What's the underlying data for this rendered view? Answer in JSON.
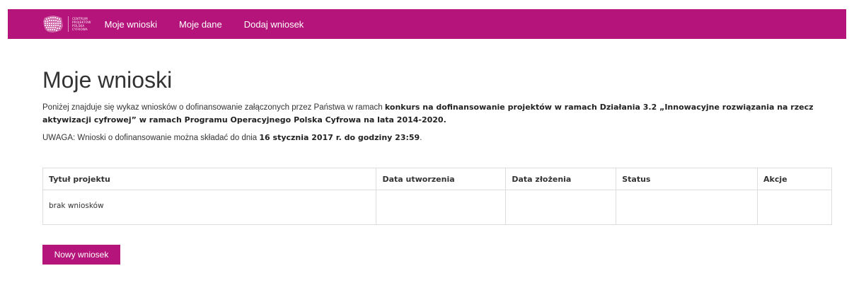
{
  "colors": {
    "brand": "#b5157a",
    "text": "#333333",
    "border": "#dddddd"
  },
  "navbar": {
    "logo": {
      "lines": [
        "CENTRUM",
        "PROJEKTÓW",
        "POLSKA",
        "CYFROWA"
      ],
      "icon": "poland-map-icon"
    },
    "links": [
      "Moje wnioski",
      "Moje dane",
      "Dodaj wniosek"
    ]
  },
  "page": {
    "title": "Moje wnioski",
    "intro_plain": "Poniżej znajduje się wykaz wniosków o dofinansowanie załączonych przez Państwa w ramach ",
    "intro_bold": "konkurs na dofinansowanie projektów w ramach Działania 3.2 „Innowacyjne rozwiązania na rzecz aktywizacji cyfrowej” w ramach Programu Operacyjnego Polska Cyfrowa na lata 2014-2020.",
    "note_plain": "UWAGA: Wnioski o dofinansowanie można składać do dnia ",
    "note_bold": "16 stycznia 2017 r. do godziny 23:59",
    "note_end": "."
  },
  "table": {
    "headers": [
      "Tytuł projektu",
      "Data utworzenia",
      "Data złożenia",
      "Status",
      "Akcje"
    ],
    "empty_message": "brak wniosków"
  },
  "actions": {
    "new_button": "Nowy wniosek"
  }
}
